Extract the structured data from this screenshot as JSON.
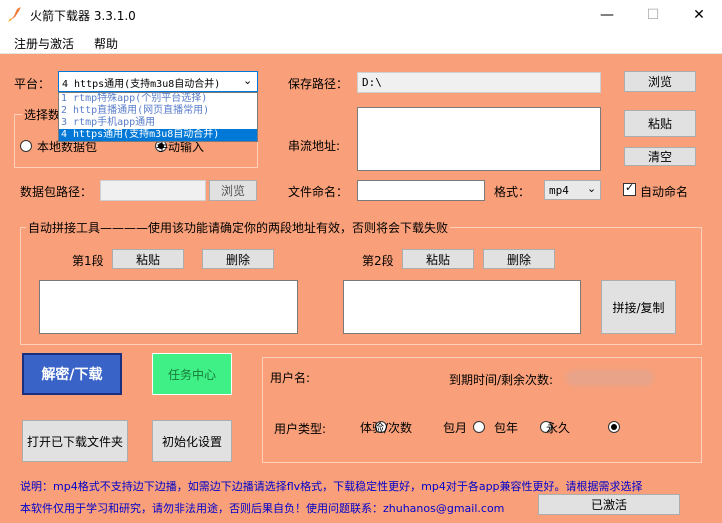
{
  "window": {
    "title": "火箭下载器  3.3.1.0",
    "minimize": "—",
    "maximize": "☐",
    "close": "✕"
  },
  "menu": {
    "items": [
      "注册与激活",
      "帮助"
    ]
  },
  "platform": {
    "label": "平台：",
    "selected": "4 https通用(支持m3u8自动合并)",
    "options": [
      "1 rtmp特殊app(个别平台选择)",
      "2 http直播通用(网页直播常用)",
      "3 rtmp手机app通用",
      "4 https通用(支持m3u8自动合并)"
    ]
  },
  "select_group": {
    "label": "选择数",
    "option_local": "本地数据包",
    "option_manual": "手动输入",
    "selected": "手动输入"
  },
  "save_path": {
    "label": "保存路径：",
    "value": "D:\\",
    "browse": "浏览"
  },
  "stream": {
    "label": "串流地址:",
    "value": "",
    "paste": "粘贴",
    "clear": "清空"
  },
  "datapack": {
    "label": "数据包路径：",
    "value": "",
    "browse": "浏览"
  },
  "filename": {
    "label": "文件命名：",
    "value": ""
  },
  "format": {
    "label": "格式：",
    "selected": "mp4",
    "auto_name_label": "自动命名",
    "auto_name_checked": true
  },
  "stitch": {
    "legend": "自动拼接工具————使用该功能请确定你的两段地址有效，否则将会下载失败",
    "seg1_label": "第1段",
    "seg2_label": "第2段",
    "paste": "粘贴",
    "delete": "删除",
    "seg1_value": "",
    "seg2_value": "",
    "stitch_button": "拼接/复制"
  },
  "actions": {
    "decrypt_download": "解密/下载",
    "task_center": "任务中心",
    "open_folder": "打开已下载文件夹",
    "init_settings": "初始化设置"
  },
  "user": {
    "username_label": "用户名:",
    "expire_label": "到期时间/剩余次数:",
    "type_label": "用户类型:",
    "types": [
      "体验/次数",
      "包月",
      "包年",
      "永久"
    ],
    "selected_type": "永久"
  },
  "notes": {
    "line1": "说明：mp4格式不支持边下边播，如需边下边播请选择flv格式，下载稳定性更好，mp4对于各app兼容性更好。请根据需求选择",
    "line2": "本软件仅用于学习和研究，请勿非法用途，否则后果自负！使用问题联系：zhuhanos@gmail.com"
  },
  "activated": "已激活",
  "colors": {
    "background": "#f9a07a",
    "primary_button": "#3a63c8",
    "task_button": "#3ef085",
    "selection": "#0078d7"
  }
}
